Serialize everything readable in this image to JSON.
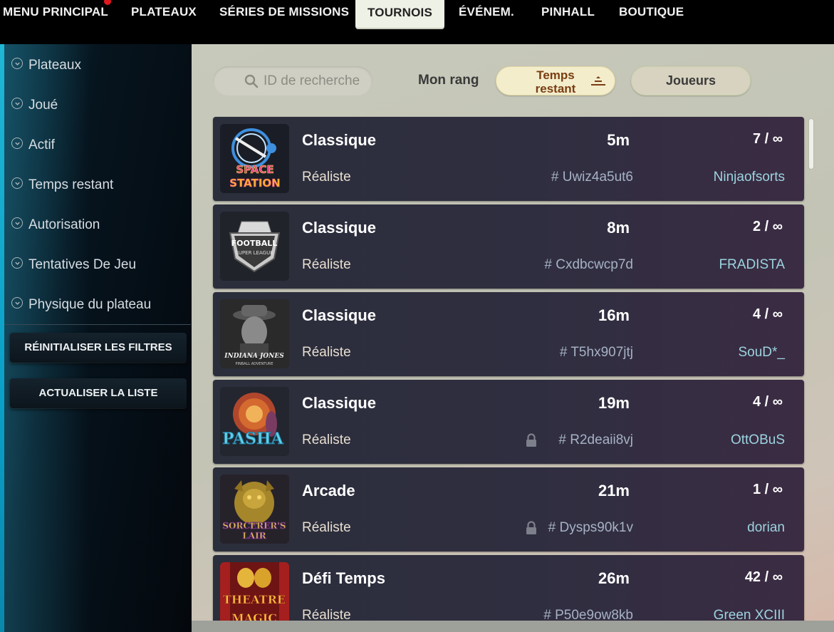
{
  "nav": {
    "items": [
      {
        "label": "MENU PRINCIPAL"
      },
      {
        "label": "PLATEAUX"
      },
      {
        "label": "SÉRIES DE MISSIONS"
      },
      {
        "label": "TOURNOIS"
      },
      {
        "label": "ÉVÉNEM."
      },
      {
        "label": "PINHALL"
      },
      {
        "label": "BOUTIQUE"
      }
    ],
    "active_index": 3,
    "notification_color": "#e0171f"
  },
  "sidebar": {
    "filters": [
      {
        "label": "Plateaux"
      },
      {
        "label": "Joué"
      },
      {
        "label": "Actif"
      },
      {
        "label": "Temps restant"
      },
      {
        "label": "Autorisation"
      },
      {
        "label": "Tentatives De Jeu"
      },
      {
        "label": "Physique du plateau"
      }
    ],
    "reset_label": "RÉINITIALISER LES FILTRES",
    "refresh_label": "ACTUALISER LA LISTE",
    "accent": "#20b6d6"
  },
  "toolbar": {
    "search_placeholder": "ID de recherche",
    "rank_label": "Mon rang",
    "sort_label_line1": "Temps",
    "sort_label_line2": "restant",
    "players_label": "Joueurs"
  },
  "tournaments": [
    {
      "type": "Classique",
      "mode": "Réaliste",
      "time": "5m",
      "id": "# Uwiz4a5ut6",
      "players": "7 / ∞",
      "holder": "Ninjaofsorts",
      "locked": false,
      "table_icon": "space-station-art"
    },
    {
      "type": "Classique",
      "mode": "Réaliste",
      "time": "8m",
      "id": "# Cxdbcwcp7d",
      "players": "2 / ∞",
      "holder": "FRADISTA",
      "locked": false,
      "table_icon": "football-super-league-art"
    },
    {
      "type": "Classique",
      "mode": "Réaliste",
      "time": "16m",
      "id": "# T5hx907jtj",
      "players": "4 / ∞",
      "holder": "SouD*_",
      "locked": false,
      "table_icon": "indiana-jones-art"
    },
    {
      "type": "Classique",
      "mode": "Réaliste",
      "time": "19m",
      "id": "# R2deaii8vj",
      "players": "4 / ∞",
      "holder": "OttOBuS",
      "locked": true,
      "table_icon": "pasha-art"
    },
    {
      "type": "Arcade",
      "mode": "Réaliste",
      "time": "21m",
      "id": "# Dysps90k1v",
      "players": "1 / ∞",
      "holder": "dorian",
      "locked": true,
      "table_icon": "sorcerers-lair-art"
    },
    {
      "type": "Défi Temps",
      "mode": "Réaliste",
      "time": "26m",
      "id": "# P50e9ow8kb",
      "players": "42 / ∞",
      "holder": "Green XCIII",
      "locked": false,
      "table_icon": "theatre-of-magic-art"
    }
  ],
  "table_art": {
    "space_station": {
      "line1": "SPACE",
      "line2": "STATION"
    },
    "football": {
      "line1": "FOOTBALL",
      "line2": "SUPER LEAGUE"
    },
    "indiana": {
      "line1": "INDIANA JONES",
      "line2": "PINBALL ADVENTURE"
    },
    "pasha": {
      "line1": "PASHA"
    },
    "sorcerer": {
      "line1": "SORCERER'S",
      "line2": "LAIR"
    },
    "theatre": {
      "line1": "THEATRE",
      "line2": "MAGIC"
    }
  }
}
